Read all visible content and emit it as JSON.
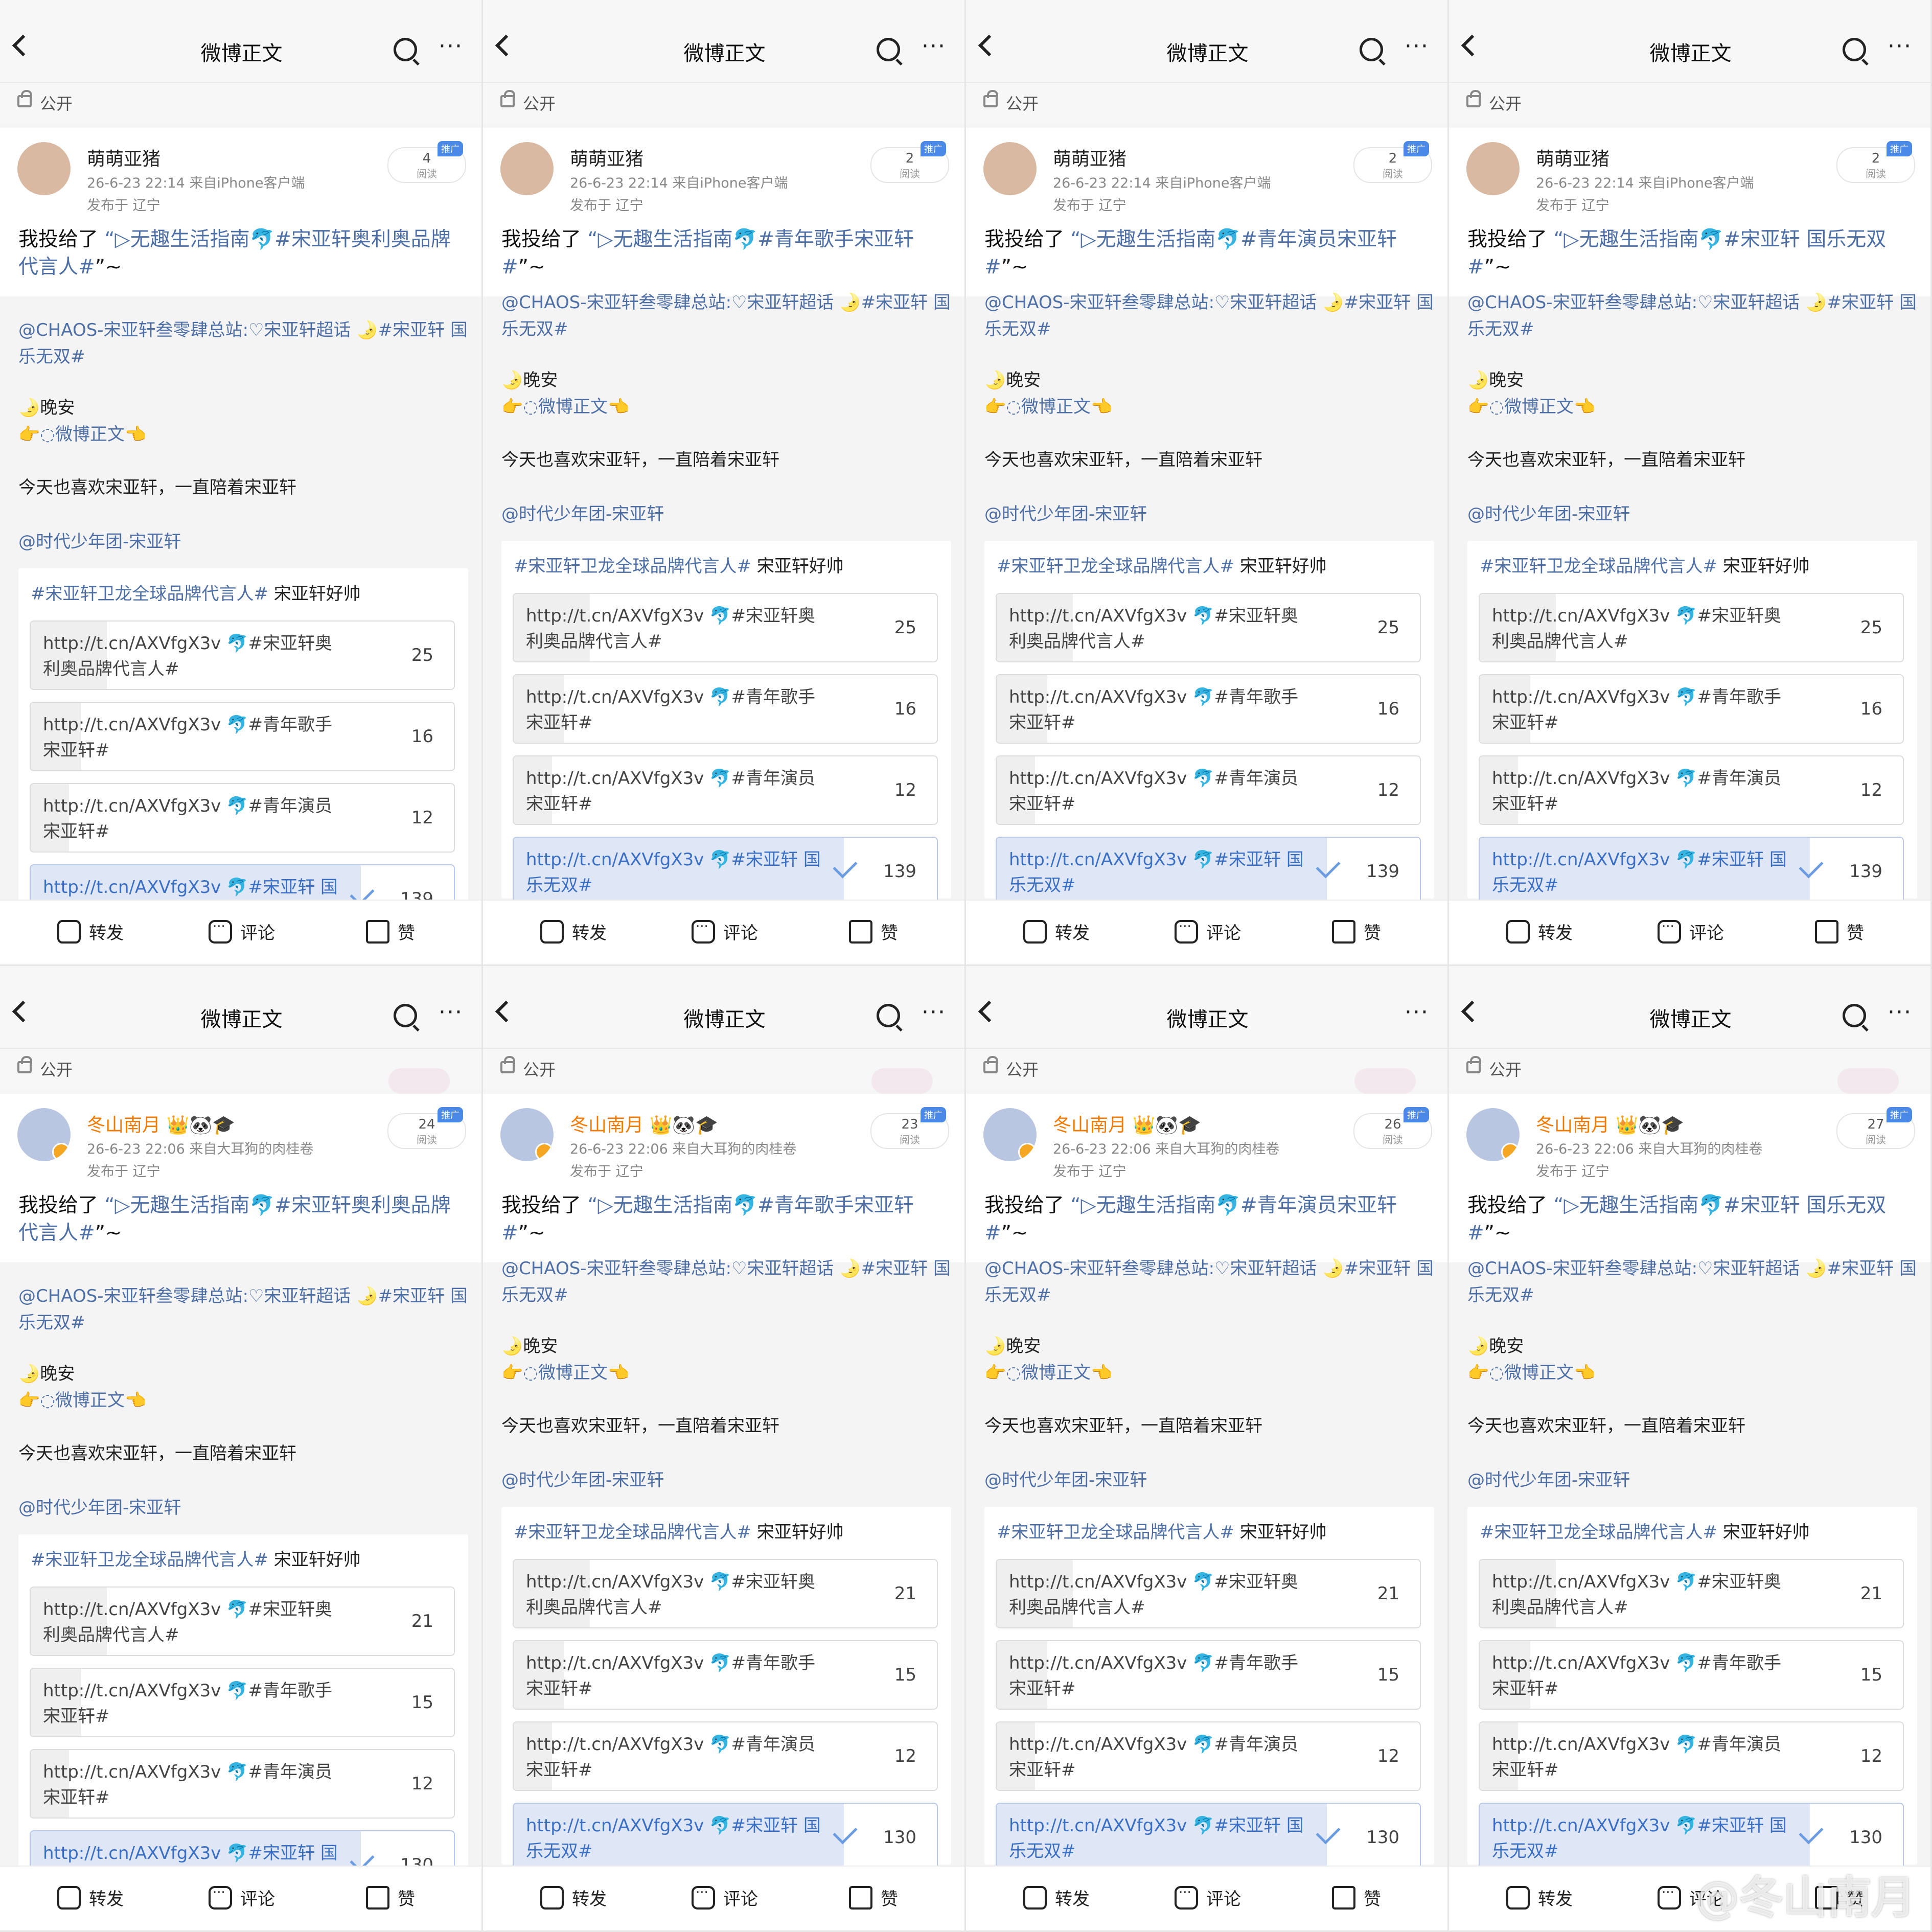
{
  "screen": {
    "nav_title": "微博正文",
    "visibility": "公开",
    "post_prefix": "我投给了",
    "post_body_open": "“▷无趣生活指南🐬",
    "post_suffix": "”~",
    "repost": {
      "line1": "@CHAOS-宋亚轩叁零肆总站:♡宋亚轩超话 🌛#宋亚轩 国乐无双#",
      "line2": "🌛晚安",
      "line3": "👉◌微博正文👈",
      "line4": "今天也喜欢宋亚轩，一直陪着宋亚轩",
      "line5": "@时代少年团-宋亚轩"
    },
    "vote_title_tag": "#宋亚轩卫龙全球品牌代言人#",
    "vote_title_text": " 宋亚轩好帅",
    "toolbar": {
      "forward": "转发",
      "comment": "评论",
      "like": "赞"
    },
    "reads_label": "阅读",
    "promo_label": "推广",
    "location": "发布于 辽宁"
  },
  "panels": [
    {
      "user": "萌萌亚猪",
      "meta": "26-6-23 22:14  来自iPhone客户端",
      "reads": "4",
      "tag": "#宋亚轩奥利奥品牌代言人#",
      "votes": [
        "25",
        "16",
        "12",
        "139"
      ]
    },
    {
      "user": "萌萌亚猪",
      "meta": "26-6-23 22:14  来自iPhone客户端",
      "reads": "2",
      "tag": "#青年歌手宋亚轩#",
      "votes": [
        "25",
        "16",
        "12",
        "139"
      ]
    },
    {
      "user": "萌萌亚猪",
      "meta": "26-6-23 22:14  来自iPhone客户端",
      "reads": "2",
      "tag": "#青年演员宋亚轩#",
      "votes": [
        "25",
        "16",
        "12",
        "139"
      ]
    },
    {
      "user": "萌萌亚猪",
      "meta": "26-6-23 22:14  来自iPhone客户端",
      "reads": "2",
      "tag": "#宋亚轩 国乐无双#",
      "votes": [
        "25",
        "16",
        "12",
        "139"
      ]
    },
    {
      "user": "冬山南月 👑🐼🎓",
      "meta": "26-6-23 22:06  来自大耳狗的肉桂卷",
      "reads": "24",
      "tag": "#宋亚轩奥利奥品牌代言人#",
      "votes": [
        "21",
        "15",
        "12",
        "130"
      ]
    },
    {
      "user": "冬山南月 👑🐼🎓",
      "meta": "26-6-23 22:06  来自大耳狗的肉桂卷",
      "reads": "23",
      "tag": "#青年歌手宋亚轩#",
      "votes": [
        "21",
        "15",
        "12",
        "130"
      ]
    },
    {
      "user": "冬山南月 👑🐼🎓",
      "meta": "26-6-23 22:06  来自大耳狗的肉桂卷",
      "reads": "26",
      "tag": "#青年演员宋亚轩#",
      "votes": [
        "21",
        "15",
        "12",
        "130"
      ]
    },
    {
      "user": "冬山南月 👑🐼🎓",
      "meta": "26-6-23 22:06  来自大耳狗的肉桂卷",
      "reads": "27",
      "tag": "#宋亚轩 国乐无双#",
      "votes": [
        "21",
        "15",
        "12",
        "130"
      ]
    }
  ],
  "vote_options": [
    "http://t.cn/AXVfgX3v 🐬#宋亚轩奥利奥品牌代言人#",
    "http://t.cn/AXVfgX3v 🐬#青年歌手宋亚轩#",
    "http://t.cn/AXVfgX3v 🐬#青年演员宋亚轩#",
    "http://t.cn/AXVfgX3v 🐬#宋亚轩 国乐无双#"
  ],
  "vote_fill": [
    0.18,
    0.12,
    0.09,
    0.78
  ],
  "selected_option": 3,
  "watermark": "@冬山南月",
  "colors": {
    "link": "#4d6fa6",
    "accent": "#f27b00",
    "promo": "#4a8ae6"
  }
}
